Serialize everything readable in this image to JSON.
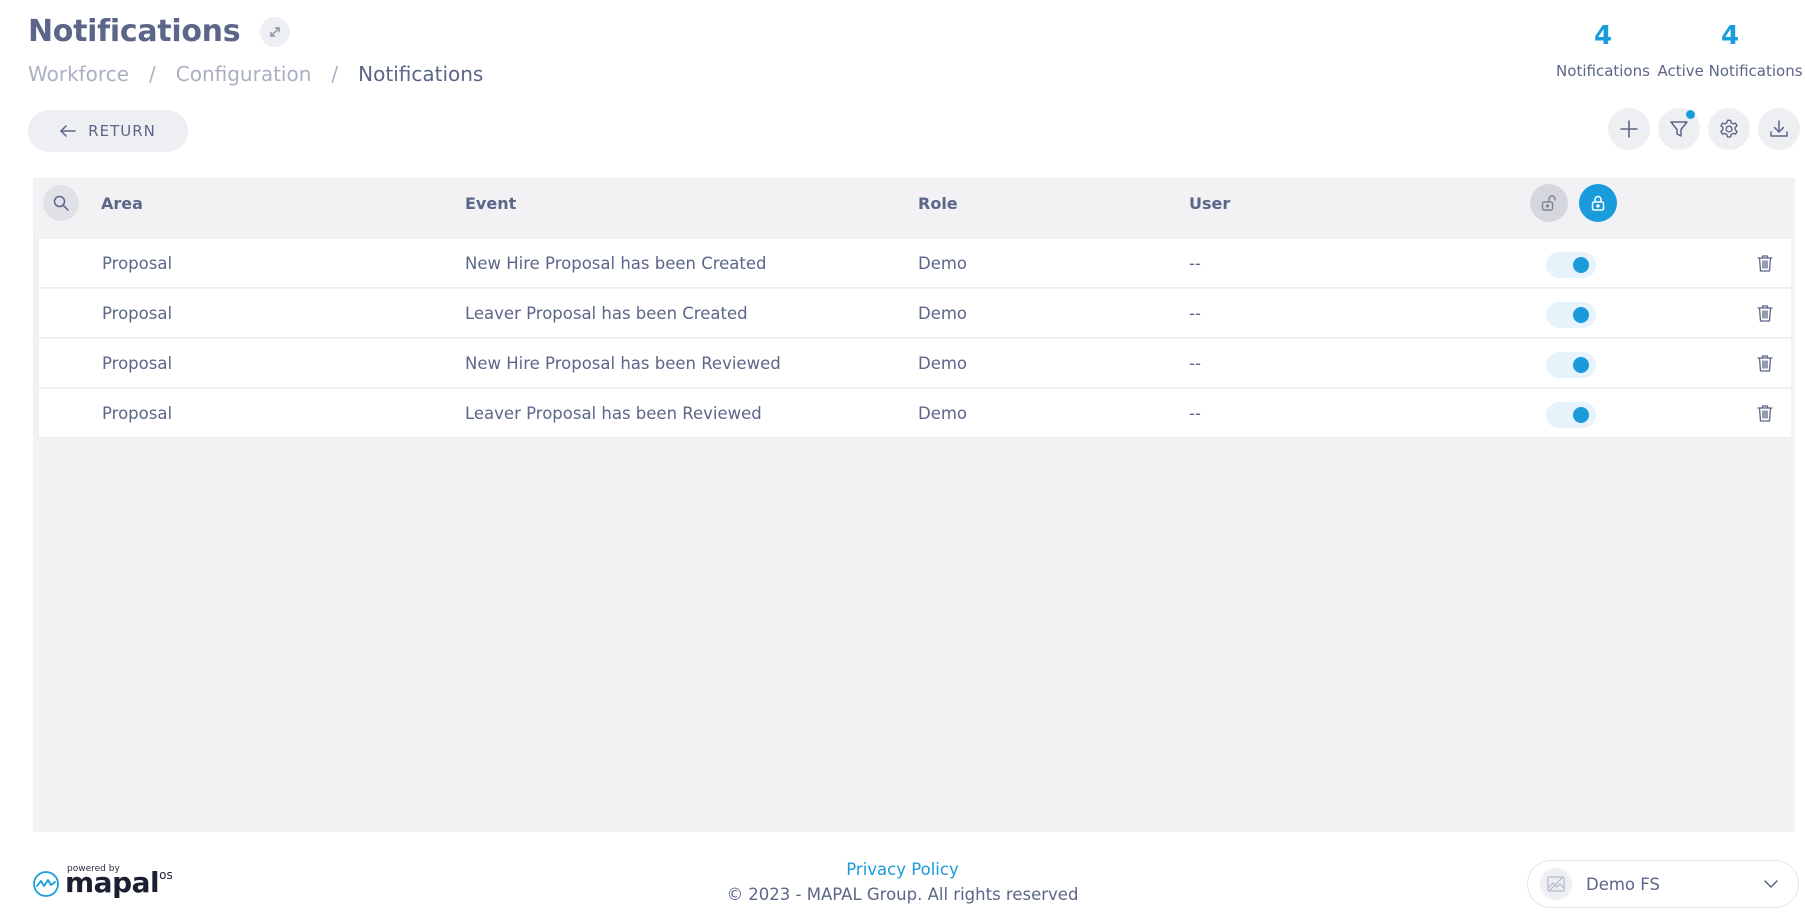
{
  "header": {
    "title": "Notifications",
    "breadcrumb": [
      "Workforce",
      "Configuration",
      "Notifications"
    ],
    "breadcrumb_separator": "/"
  },
  "stats": [
    {
      "value": "4",
      "label": "Notifications"
    },
    {
      "value": "4",
      "label": "Active Notifications"
    }
  ],
  "toolbar": {
    "return_label": "RETURN",
    "actions": [
      "add-icon",
      "filter-icon",
      "gear-icon",
      "download-icon"
    ],
    "filter_active": true
  },
  "table": {
    "columns": {
      "area": "Area",
      "event": "Event",
      "role": "Role",
      "user": "User"
    },
    "rows": [
      {
        "area": "Proposal",
        "event": "New Hire Proposal has been Created",
        "role": "Demo",
        "user": "--",
        "enabled": true
      },
      {
        "area": "Proposal",
        "event": "Leaver Proposal has been Created",
        "role": "Demo",
        "user": "--",
        "enabled": true
      },
      {
        "area": "Proposal",
        "event": "New Hire Proposal has been Reviewed",
        "role": "Demo",
        "user": "--",
        "enabled": true
      },
      {
        "area": "Proposal",
        "event": "Leaver Proposal has been Reviewed",
        "role": "Demo",
        "user": "--",
        "enabled": true
      }
    ]
  },
  "footer": {
    "powered_by": "powered by",
    "brand": "mapal",
    "brand_suffix": "os",
    "privacy_label": "Privacy Policy",
    "copyright": "© 2023 - MAPAL Group. All rights reserved",
    "company": "Demo FS"
  },
  "colors": {
    "accent": "#1a9bdc",
    "text": "#5b6688",
    "muted": "#aab0c2",
    "panel": "#f2f2f4"
  }
}
